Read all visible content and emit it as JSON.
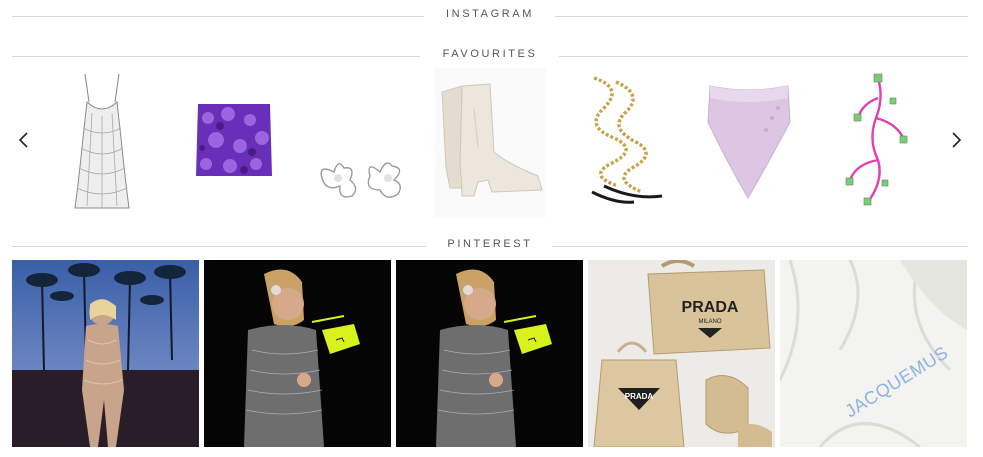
{
  "sections": {
    "instagram": "INSTAGRAM",
    "favourites": "FAVOURITES",
    "pinterest": "PINTEREST"
  },
  "carousel": {
    "prev_icon": "chevron-left-icon",
    "next_icon": "chevron-right-icon",
    "items": [
      "crystal-mini-dress",
      "purple-sequin-skirt",
      "butterfly-crystal-earrings",
      "white-western-boots",
      "gold-chain-sandals",
      "lilac-bandana-top",
      "pink-jewelled-earring"
    ]
  },
  "pinterest": {
    "tiles": [
      {
        "name": "palm-trees-night-dress-photo"
      },
      {
        "name": "crystal-dress-neon-bag-photo"
      },
      {
        "name": "crystal-dress-neon-bag-photo-2"
      },
      {
        "name": "prada-raffia-bags-photo",
        "brand_top": "PRADA",
        "brand_sub": "MILANO",
        "brand_bottom": "PRADA"
      },
      {
        "name": "jacquemus-shirt-photo",
        "brand": "JACQUEMUS"
      }
    ]
  },
  "colors": {
    "line": "#d8d8d8",
    "title": "#555555",
    "sequin": "#6a2fb8",
    "neon": "#d9f21c",
    "pink": "#e23fb5",
    "lilac": "#d9bfe0"
  }
}
